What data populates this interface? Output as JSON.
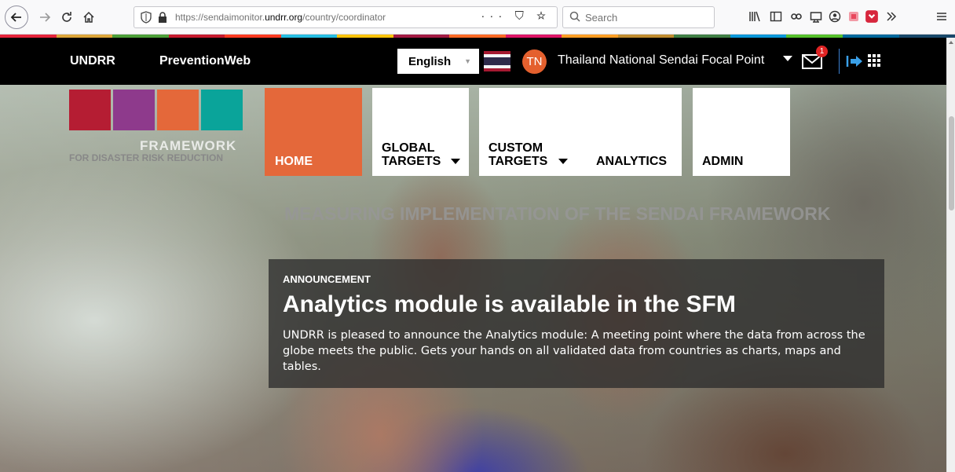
{
  "browser": {
    "url_prefix": "https://sendaimonitor.",
    "url_domain": "undrr.org",
    "url_path": "/country/coordinator",
    "url_actions": "··· ⛉ ☆",
    "search_placeholder": "Search"
  },
  "topbar": {
    "links": [
      "UNDRR",
      "PreventionWeb"
    ],
    "language": "English",
    "user_initials": "TN",
    "user_name": "Thailand National Sendai Focal Point",
    "mail_count": "1"
  },
  "logo": {
    "colors": [
      "#b51d33",
      "#8e3a8c",
      "#e4683a",
      "#0aa49a"
    ],
    "word": "FRAMEWORK",
    "subtitle": "FOR DISASTER RISK REDUCTION"
  },
  "nav": {
    "home": "HOME",
    "global_targets_1": "GLOBAL",
    "global_targets_2": "TARGETS",
    "custom_targets_1": "CUSTOM",
    "custom_targets_2": "TARGETS",
    "analytics": "ANALYTICS",
    "admin": "ADMIN"
  },
  "hero": {
    "title": "MEASURING IMPLEMENTATION OF THE SENDAI FRAMEWORK"
  },
  "announcement": {
    "label": "ANNOUNCEMENT",
    "title": "Analytics module is available in the SFM",
    "body": "UNDRR is pleased to announce the Analytics module: A meeting point where the data from across the globe meets the public. Gets your hands on all validated data from countries as charts, maps and tables."
  }
}
